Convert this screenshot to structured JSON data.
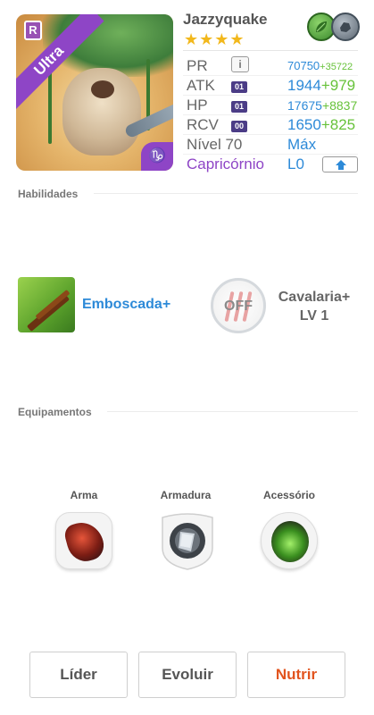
{
  "monster": {
    "name": "Jazzyquake",
    "rarity_label": "Ultra",
    "stars": "★★★★",
    "corner_glyph": "♑",
    "r_badge": "R",
    "elements": [
      "leaf-icon",
      "rock-icon"
    ]
  },
  "stats": {
    "pr": {
      "label": "PR",
      "value": "70750",
      "bonus": "+35722"
    },
    "atk": {
      "label": "ATK",
      "level": "01",
      "value": "1944",
      "bonus": "+979"
    },
    "hp": {
      "label": "HP",
      "level": "01",
      "value": "17675",
      "bonus": "+8837"
    },
    "rcv": {
      "label": "RCV",
      "level": "00",
      "value": "1650",
      "bonus": "+825"
    },
    "level": {
      "label": "Nível 70",
      "value": "Máx"
    },
    "sign": {
      "label": "Capricórnio",
      "value": "L0"
    }
  },
  "skills_section": {
    "title": "Habilidades",
    "active": {
      "name": "Emboscada+"
    },
    "passive": {
      "state": "OFF",
      "name": "Cavalaria+",
      "level": "LV 1"
    }
  },
  "equipment_section": {
    "title": "Equipamentos",
    "slots": [
      {
        "label": "Arma",
        "icon": "weapon-icon"
      },
      {
        "label": "Armadura",
        "icon": "armor-icon"
      },
      {
        "label": "Acessório",
        "icon": "accessory-icon"
      }
    ]
  },
  "buttons": {
    "leader": "Líder",
    "evolve": "Evoluir",
    "feed": "Nutrir"
  },
  "colors": {
    "accent_blue": "#2d8ad8",
    "bonus_green": "#67c23a",
    "ultra_purple": "#8e45c6",
    "feed_orange": "#e2541e",
    "star_gold": "#f2b81c"
  }
}
